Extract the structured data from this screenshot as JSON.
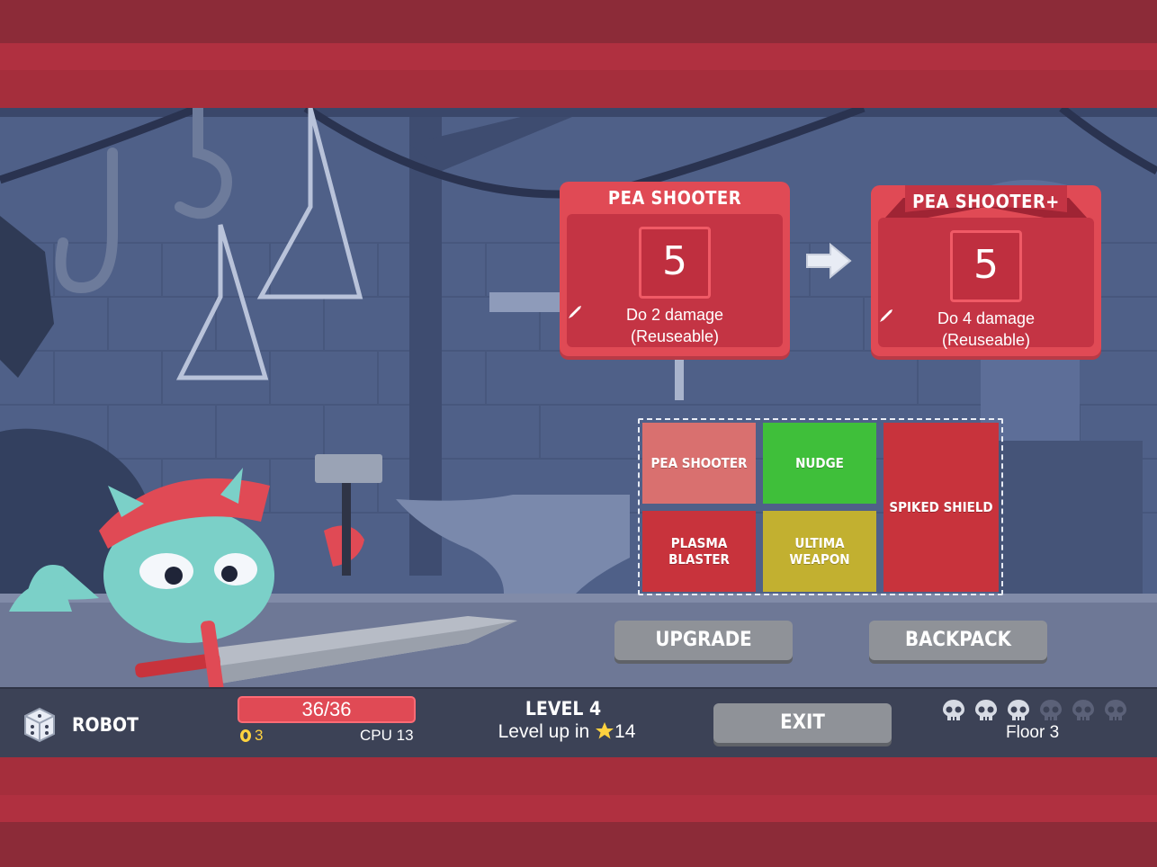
{
  "upgrade_preview": {
    "before": {
      "title": "PEA SHOOTER",
      "value": "5",
      "desc_pre": "Do",
      "desc_amount": "2 damage",
      "desc_note": "(Reuseable)"
    },
    "after": {
      "title": "PEA SHOOTER+",
      "value": "5",
      "desc_pre": "Do",
      "desc_amount": "4 damage",
      "desc_note": "(Reuseable)"
    }
  },
  "equipment": {
    "slots": [
      {
        "label": "PEA SHOOTER",
        "color": "#d9706f"
      },
      {
        "label": "NUDGE",
        "color": "#3fbf3a"
      },
      {
        "label": "SPIKED SHIELD",
        "color": "#c8333c"
      },
      {
        "label": "PLASMA BLASTER",
        "color": "#c8333c"
      },
      {
        "label": "ULTIMA WEAPON",
        "color": "#c2b030"
      }
    ]
  },
  "actions": {
    "upgrade": "UPGRADE",
    "backpack": "BACKPACK",
    "exit": "EXIT"
  },
  "hud": {
    "character": "ROBOT",
    "hp": "36/36",
    "gold": "3",
    "cpu": "CPU 13",
    "level": "LEVEL 4",
    "level_up_pre": "Level up in",
    "level_up_amount": "14",
    "floor": "Floor 3",
    "floor_progress": {
      "cleared": 3,
      "total": 6
    }
  },
  "colors": {
    "card": "#e04a55",
    "card_inner": "#c43444",
    "hud_bg": "#3c4256",
    "accent_gold": "#ffd23f"
  }
}
